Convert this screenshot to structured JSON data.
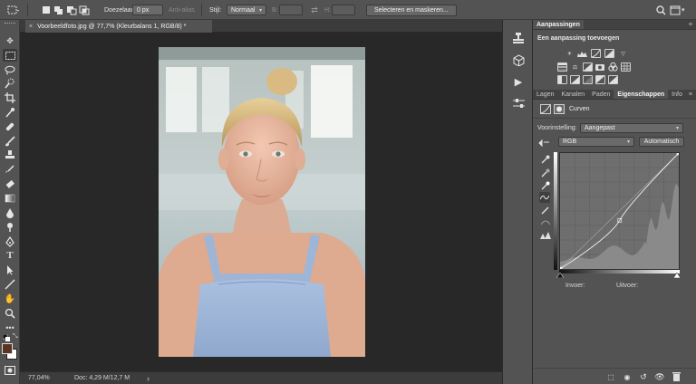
{
  "options_bar": {
    "feather_label": "Doezelaar:",
    "feather_value": "0 px",
    "antialias_label": "Anti-alias",
    "style_label": "Stijl:",
    "style_value": "Normaal",
    "width_label": "B:",
    "height_label": "H:",
    "select_mask_label": "Selecteren en maskeren..."
  },
  "document_tab": {
    "title": "Voorbeeldfoto.jpg @ 77,7% (Kleurbalans 1, RGB/8) *",
    "close": "×"
  },
  "status_bar": {
    "zoom": "77,04%",
    "doc_info": "Doc: 4,29 M/12,7 M",
    "arrow": "›"
  },
  "adjustments_panel": {
    "title": "Aanpassingen",
    "subtitle": "Een aanpassing toevoegen"
  },
  "properties_panel": {
    "tabs": [
      {
        "label": "Lagen"
      },
      {
        "label": "Kanalen"
      },
      {
        "label": "Paden"
      },
      {
        "label": "Eigenschappen"
      },
      {
        "label": "Info"
      }
    ],
    "active_tab": "Eigenschappen",
    "layer_type": "Curven",
    "preset_label": "Voorinstelling:",
    "preset_value": "Aangepast",
    "channel_value": "RGB",
    "auto_button": "Automatisch",
    "input_label": "Invoer:",
    "output_label": "Uitvoer:"
  },
  "curve": {
    "points": [
      [
        0,
        0
      ],
      [
        128,
        107
      ],
      [
        255,
        255
      ]
    ]
  },
  "colors": {
    "foreground": "#5a3322",
    "background": "#ffffff",
    "panel": "#535353",
    "workspace": "#282828"
  }
}
